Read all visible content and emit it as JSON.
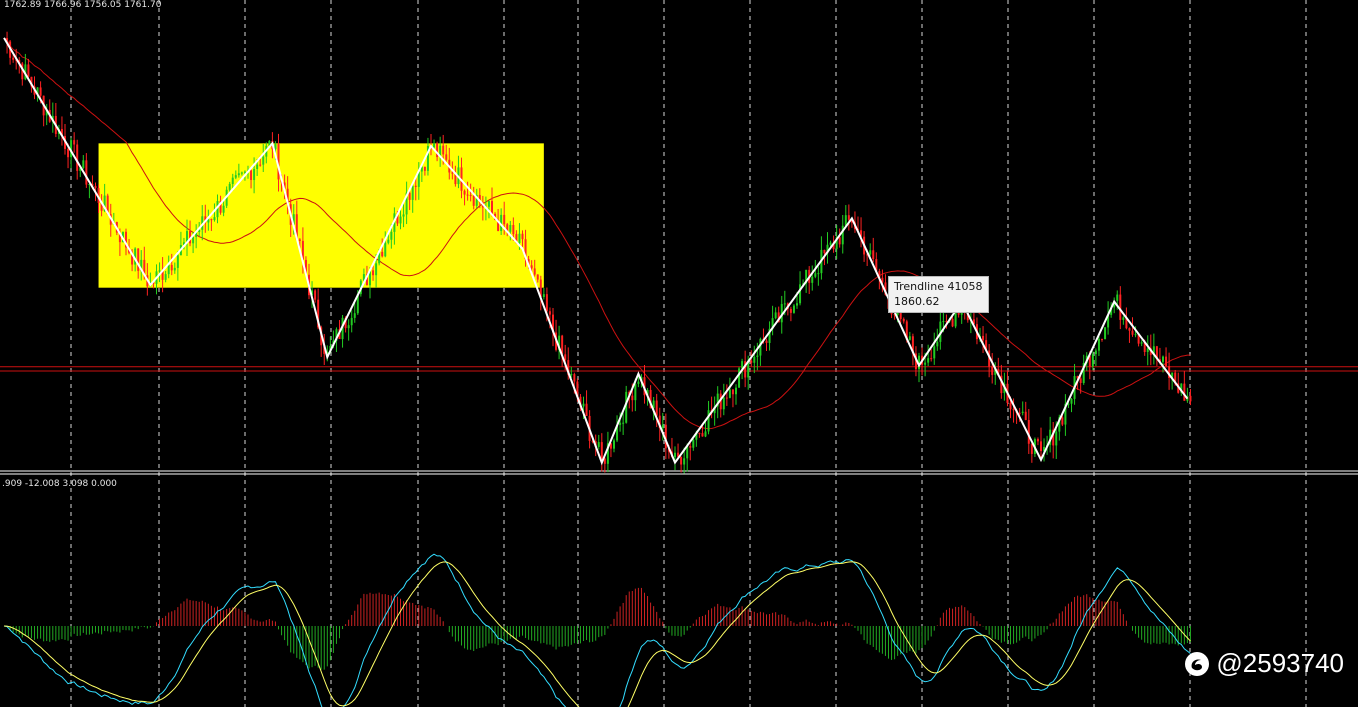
{
  "header": {
    "ohlc_text": "1762.89 1766.96 1756.05 1761.70"
  },
  "macd_panel": {
    "values_text": ".909 -12.008 3.098 0.000"
  },
  "tooltip": {
    "title": "Trendline 41058",
    "value": "1860.62"
  },
  "watermark": {
    "text": "@2593740",
    "icon": "weibo-logo-icon"
  },
  "colors": {
    "background": "#000000",
    "bull_candle": "#22cc22",
    "bear_candle": "#ff2222",
    "zigzag": "#ffffff",
    "moving_average": "#cc1111",
    "highlight_box": "#ffff00",
    "macd_line": "#33ddff",
    "signal_line": "#ffff66",
    "hist_pos": "#cc2222",
    "hist_neg": "#22aa22",
    "grid": "#ffffff"
  },
  "chart_data": {
    "type": "candlestick",
    "title": "",
    "xlabel": "",
    "ylabel": "",
    "grid": true,
    "zigzag_anchors": [
      {
        "index": 0,
        "price": 1905
      },
      {
        "index": 48,
        "price": 1816
      },
      {
        "index": 88,
        "price": 1867
      },
      {
        "index": 106,
        "price": 1790
      },
      {
        "index": 140,
        "price": 1866
      },
      {
        "index": 170,
        "price": 1829
      },
      {
        "index": 196,
        "price": 1752
      },
      {
        "index": 208,
        "price": 1784
      },
      {
        "index": 220,
        "price": 1752
      },
      {
        "index": 278,
        "price": 1840
      },
      {
        "index": 300,
        "price": 1787
      },
      {
        "index": 314,
        "price": 1810
      },
      {
        "index": 340,
        "price": 1753
      },
      {
        "index": 364,
        "price": 1810
      },
      {
        "index": 388,
        "price": 1775
      }
    ],
    "highlight_zone": {
      "start_index": 31,
      "end_index": 177,
      "price_high": 1867,
      "price_low": 1815
    },
    "horizontal_levels": [
      1786.5,
      1785
    ],
    "tooltip_level": 1860.62,
    "macd": {
      "hist_levels": "derived",
      "note_text": ""
    }
  }
}
